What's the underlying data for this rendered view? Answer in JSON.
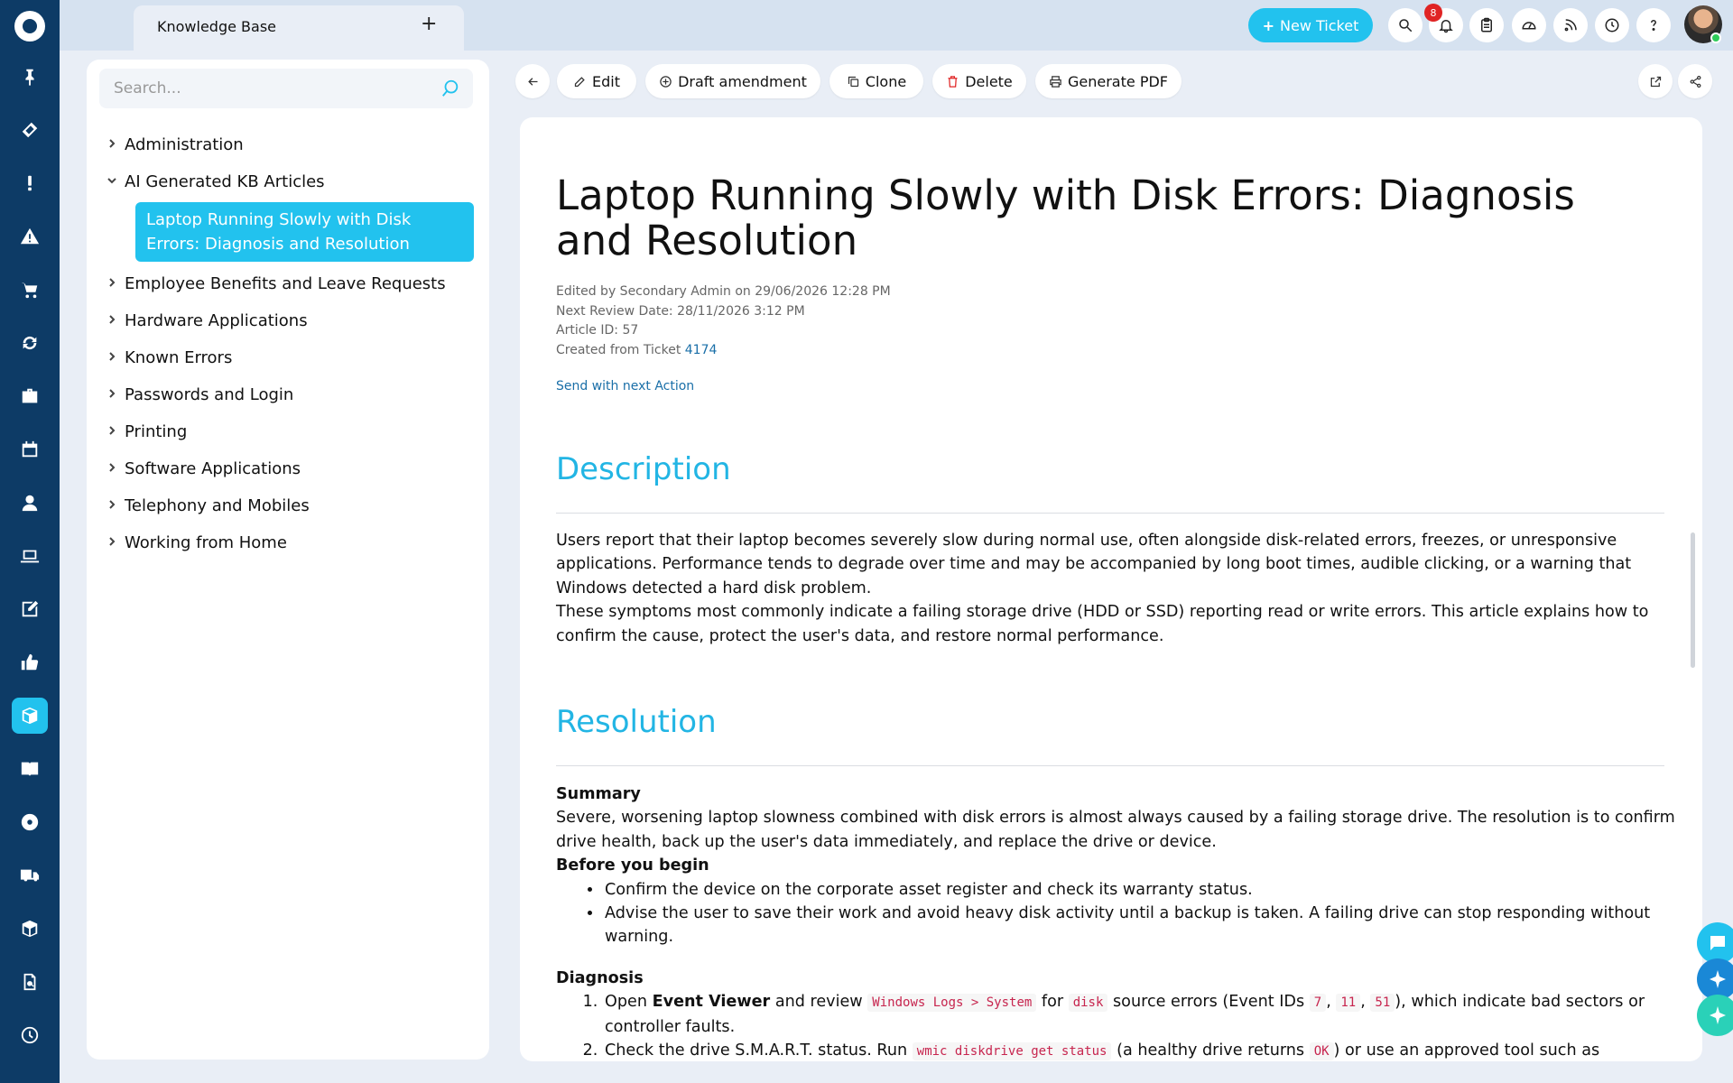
{
  "topbar": {
    "tab_label": "Knowledge Base",
    "add_tab": "+",
    "new_ticket_label": "New Ticket",
    "notification_count": "8"
  },
  "sidebar_search": {
    "placeholder": "Search..."
  },
  "tree": {
    "items": [
      {
        "label": "Administration",
        "expanded": false
      },
      {
        "label": "AI Generated KB Articles",
        "expanded": true
      },
      {
        "label": "Employee Benefits and Leave Requests",
        "expanded": false
      },
      {
        "label": "Hardware Applications",
        "expanded": false
      },
      {
        "label": "Known Errors",
        "expanded": false
      },
      {
        "label": "Passwords and Login",
        "expanded": false
      },
      {
        "label": "Printing",
        "expanded": false
      },
      {
        "label": "Software Applications",
        "expanded": false
      },
      {
        "label": "Telephony and Mobiles",
        "expanded": false
      },
      {
        "label": "Working from Home",
        "expanded": false
      }
    ],
    "selected_article": "Laptop Running Slowly with Disk Errors: Diagnosis and Resolution"
  },
  "toolbar": {
    "edit": "Edit",
    "draft": "Draft amendment",
    "clone": "Clone",
    "delete": "Delete",
    "pdf": "Generate PDF"
  },
  "article": {
    "title": "Laptop Running Slowly with Disk Errors: Diagnosis and Resolution",
    "meta_edited": "Edited by Secondary Admin on 29/06/2026 12:28 PM",
    "meta_review": "Next Review Date: 28/11/2026 3:12 PM",
    "meta_id": "Article ID: 57",
    "meta_created_prefix": "Created from Ticket",
    "meta_ticket": "4174",
    "send_link": "Send with next Action",
    "description_heading": "Description",
    "description_p1": "Users report that their laptop becomes severely slow during normal use, often alongside disk-related errors, freezes, or unresponsive applications. Performance tends to degrade over time and may be accompanied by long boot times, audible clicking, or a warning that Windows detected a hard disk problem.",
    "description_p2": "These symptoms most commonly indicate a failing storage drive (HDD or SSD) reporting read or write errors. This article explains how to confirm the cause, protect the user's data, and restore normal performance.",
    "resolution_heading": "Resolution",
    "summary_heading": "Summary",
    "summary_text": "Severe, worsening laptop slowness combined with disk errors is almost always caused by a failing storage drive. The resolution is to confirm drive health, back up the user's data immediately, and replace the drive or device.",
    "before_heading": "Before you begin",
    "before_items": [
      "Confirm the device on the corporate asset register and check its warranty status.",
      "Advise the user to save their work and avoid heavy disk activity until a backup is taken. A failing drive can stop responding without warning."
    ],
    "diagnosis_heading": "Diagnosis",
    "diag1_a": "Open",
    "diag1_b": "Event Viewer",
    "diag1_c": "and review",
    "diag1_code1": "Windows Logs > System",
    "diag1_d": "for",
    "diag1_code2": "disk",
    "diag1_e": "source errors (Event IDs",
    "diag1_id1": "7",
    "diag1_id2": "11",
    "diag1_id3": "51",
    "diag1_f": "), which indicate bad sectors or controller faults.",
    "diag2_a": "Check the drive S.M.A.R.T. status. Run",
    "diag2_code": "wmic diskdrive get status",
    "diag2_b": "(a healthy drive returns",
    "diag2_ok": "OK",
    "diag2_c": ") or use an approved tool such as"
  },
  "colors": {
    "rail": "#0d3b66",
    "accent": "#22c2ee",
    "badge": "#e02424"
  }
}
